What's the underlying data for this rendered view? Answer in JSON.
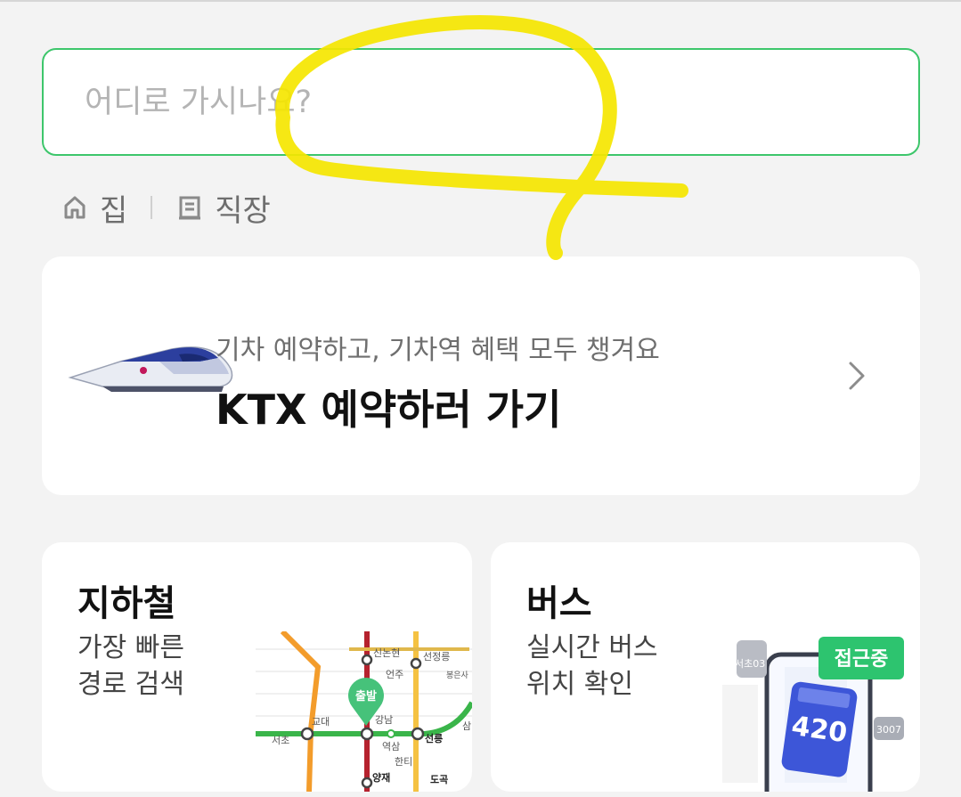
{
  "search": {
    "placeholder": "어디로 가시나요?",
    "value": ""
  },
  "shortcuts": [
    {
      "label": "집",
      "icon": "home-icon"
    },
    {
      "label": "직장",
      "icon": "building-icon"
    }
  ],
  "ktx_card": {
    "subtitle": "기차 예약하고, 기차역 혜택 모두 챙겨요",
    "title": "KTX 예약하러 가기",
    "image": "ktx-train-image",
    "icon": "chevron-right-icon"
  },
  "subway_card": {
    "title": "지하철",
    "desc_line1": "가장 빠른",
    "desc_line2": "경로 검색",
    "map": {
      "start_pin": "출발",
      "stations": [
        "신논현",
        "선정릉",
        "언주",
        "봉은사",
        "교대",
        "강남",
        "역삼",
        "선릉",
        "서초",
        "한티",
        "양재",
        "도곡",
        "삼"
      ]
    }
  },
  "bus_card": {
    "title": "버스",
    "desc_line1": "실시간 버스",
    "desc_line2": "위치 확인",
    "badge": "접근중",
    "bus_number": "420",
    "other_buses": [
      "서초03",
      "3007"
    ]
  },
  "colors": {
    "accent_green": "#3dc66b",
    "line2_green": "#3ab54a",
    "scribble_yellow": "#f5e600"
  }
}
